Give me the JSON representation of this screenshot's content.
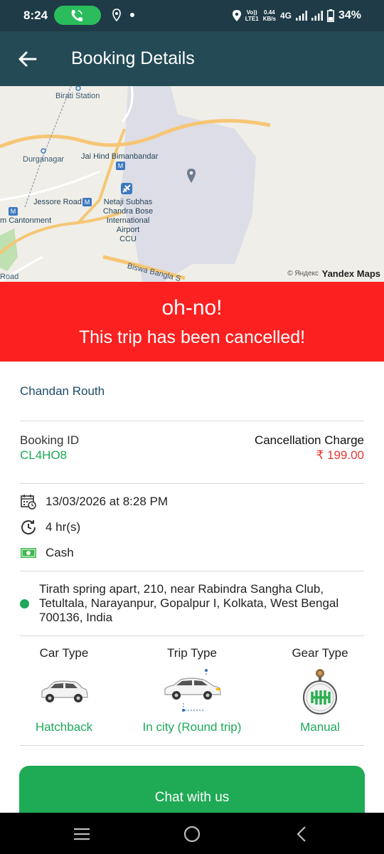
{
  "status_bar": {
    "time": "8:24",
    "network_top": "Vo))",
    "network_bottom": "LTE1",
    "speed_top": "0.44",
    "speed_bottom": "KB/s",
    "network_type": "4G",
    "battery": "34%"
  },
  "app_bar": {
    "title": "Booking Details"
  },
  "map": {
    "labels": {
      "birati": "Birati Station",
      "durganagar": "Durganagar",
      "jaihind": "Jai Hind Bimanbandar",
      "jessore": "Jessore Road",
      "cantonment": "m Cantonment",
      "airport_line1": "Netaji Subhas",
      "airport_line2": "Chandra Bose",
      "airport_line3": "International",
      "airport_line4": "Airport",
      "airport_line5": "CCU",
      "biswa": "Biswa Bangla S",
      "road": "Road"
    },
    "copyright": "© Яндекс",
    "brand": "Yandex Maps"
  },
  "banner": {
    "title": "oh-no!",
    "message": "This trip has been cancelled!"
  },
  "driver": {
    "name": "Chandan Routh"
  },
  "booking": {
    "id_label": "Booking ID",
    "id_value": "CL4HO8",
    "charge_label": "Cancellation Charge",
    "charge_value": "₹ 199.00"
  },
  "details": {
    "datetime": "13/03/2026 at 8:28 PM",
    "duration": "4 hr(s)",
    "payment": "Cash"
  },
  "address": "Tirath spring apart, 210, near Rabindra Sangha Club, Tetultala, Narayanpur, Gopalpur I, Kolkata, West Bengal 700136, India",
  "types": {
    "car_label": "Car Type",
    "car_value": "Hatchback",
    "trip_label": "Trip Type",
    "trip_value": "In city (Round trip)",
    "gear_label": "Gear Type",
    "gear_value": "Manual"
  },
  "chat_button": "Chat with us",
  "colors": {
    "accent_green": "#1da85a",
    "banner_red": "#fc2020",
    "app_bar": "#244a56"
  }
}
